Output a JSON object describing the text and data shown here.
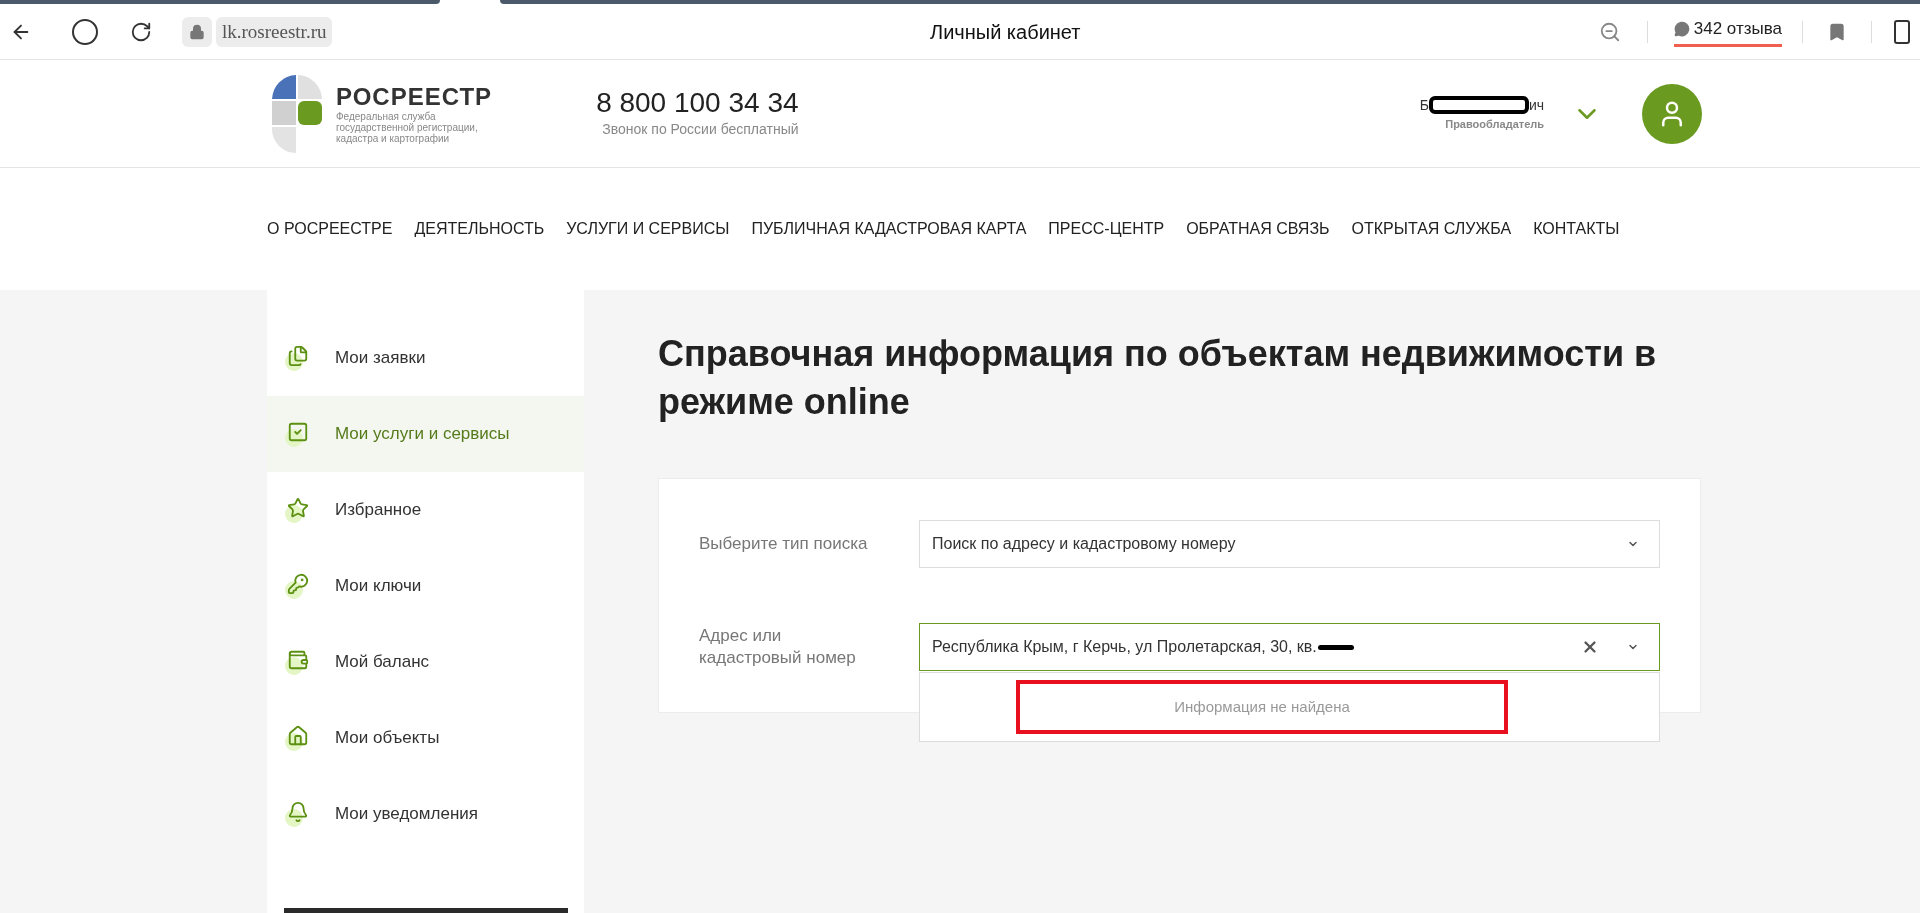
{
  "browser": {
    "url": "lk.rosreestr.ru",
    "title": "Личный кабинет",
    "reviews": "342 отзыва"
  },
  "header": {
    "logo": {
      "name": "РОСРЕЕСТР",
      "subtitle_lines": [
        "Федеральная служба",
        "государственной регистрации,",
        "кадастра и картографии"
      ]
    },
    "phone": "8 800 100 34 34",
    "phone_note": "Звонок по России бесплатный",
    "user": {
      "name_start": "Б",
      "name_end": "ич",
      "role": "Правообладатель"
    }
  },
  "nav": [
    "О РОСРЕЕСТРЕ",
    "ДЕЯТЕЛЬНОСТЬ",
    "УСЛУГИ И СЕРВИСЫ",
    "ПУБЛИЧНАЯ КАДАСТРОВАЯ КАРТА",
    "ПРЕСС-ЦЕНТР",
    "ОБРАТНАЯ СВЯЗЬ",
    "ОТКРЫТАЯ СЛУЖБА",
    "КОНТАКТЫ"
  ],
  "sidebar": {
    "items": [
      {
        "label": "Мои заявки",
        "kind": "documents",
        "selected": false
      },
      {
        "label": "Мои услуги и сервисы",
        "kind": "checklist",
        "selected": true
      },
      {
        "label": "Избранное",
        "kind": "star",
        "selected": false
      },
      {
        "label": "Мои ключи",
        "kind": "key",
        "selected": false
      },
      {
        "label": "Мой баланс",
        "kind": "wallet",
        "selected": false
      },
      {
        "label": "Мои объекты",
        "kind": "house",
        "selected": false
      },
      {
        "label": "Мои уведомления",
        "kind": "bell",
        "selected": false
      }
    ]
  },
  "page_title": "Справочная информация по объектам недвижимости в режиме online",
  "form": {
    "fields": [
      {
        "kind": "select",
        "label": "Выберите тип поиска",
        "value": "Поиск по адресу и кадастровому номеру",
        "focused": false
      },
      {
        "kind": "combobox",
        "label": "Адрес или кадастровый номер",
        "value": "Республика Крым, г Керчь, ул Пролетарская, 30, кв.",
        "focused": true
      }
    ],
    "dropdown": {
      "message": "Информация не найдена",
      "highlighted": true
    }
  }
}
